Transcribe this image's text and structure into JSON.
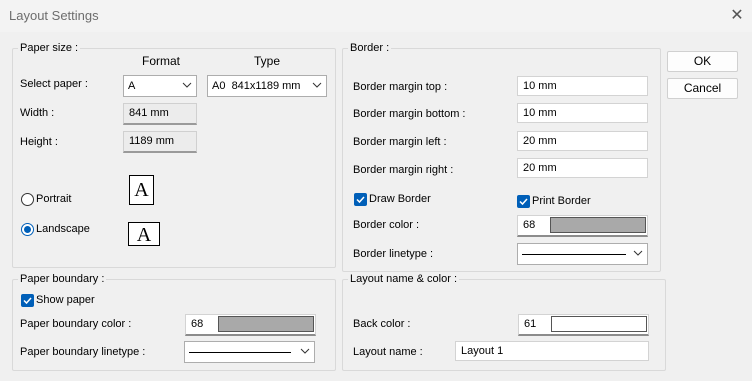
{
  "window": {
    "title": "Layout Settings",
    "close_icon": "close-icon"
  },
  "paper_size": {
    "title": "Paper size :",
    "format_header": "Format",
    "type_header": "Type",
    "select_paper_label": "Select paper :",
    "format_value": "A",
    "type_value": "A0  841x1189 mm",
    "width_label": "Width :",
    "width_value": "841 mm",
    "height_label": "Height :",
    "height_value": "1189 mm",
    "portrait_label": "Portrait",
    "landscape_label": "Landscape",
    "orientation_selected": "Landscape",
    "portrait_icon_glyph": "A",
    "landscape_icon_glyph": "A"
  },
  "border": {
    "title": "Border :",
    "margin_top_label": "Border margin top :",
    "margin_top_value": "10 mm",
    "margin_bottom_label": "Border margin bottom :",
    "margin_bottom_value": "10 mm",
    "margin_left_label": "Border margin left :",
    "margin_left_value": "20 mm",
    "margin_right_label": "Border margin right :",
    "margin_right_value": "20 mm",
    "draw_border_label": "Draw Border",
    "draw_border_checked": true,
    "print_border_label": "Print Border",
    "print_border_checked": true,
    "color_label": "Border color :",
    "color_value": "68",
    "color_swatch": "#a9a9a9",
    "linetype_label": "Border linetype :"
  },
  "paper_boundary": {
    "title": "Paper boundary :",
    "show_paper_label": "Show paper",
    "show_paper_checked": true,
    "color_label": "Paper boundary color :",
    "color_value": "68",
    "color_swatch": "#a9a9a9",
    "linetype_label": "Paper boundary linetype :"
  },
  "layout": {
    "title": "Layout name & color :",
    "back_color_label": "Back color :",
    "back_color_value": "61",
    "back_color_swatch": "#ffffff",
    "name_label": "Layout name :",
    "name_value": "Layout 1"
  },
  "buttons": {
    "ok": "OK",
    "cancel": "Cancel"
  },
  "colors": {
    "accent": "#005fb8",
    "background": "#f0f0f0"
  }
}
